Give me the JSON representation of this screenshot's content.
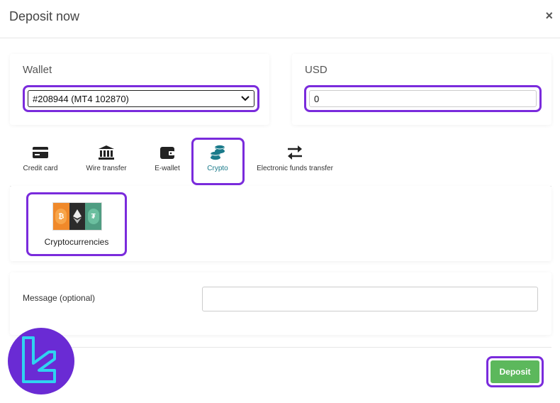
{
  "header": {
    "title": "Deposit now",
    "close_glyph": "×"
  },
  "wallet": {
    "label": "Wallet",
    "selected": "#208944 (MT4 102870)"
  },
  "amount": {
    "label": "USD",
    "value": "0"
  },
  "tabs": [
    {
      "label": "Credit card",
      "icon": "credit-card-icon"
    },
    {
      "label": "Wire transfer",
      "icon": "bank-icon"
    },
    {
      "label": "E-wallet",
      "icon": "wallet-icon"
    },
    {
      "label": "Crypto",
      "icon": "coins-icon",
      "active": true
    },
    {
      "label": "Electronic funds transfer",
      "icon": "exchange-arrows-icon"
    }
  ],
  "methods": [
    {
      "label": "Cryptocurrencies"
    }
  ],
  "message": {
    "label": "Message (optional)",
    "value": ""
  },
  "footer": {
    "deposit_label": "Deposit"
  },
  "colors": {
    "highlight": "#7a2bdc",
    "deposit": "#5cb85c",
    "crypto_tab": "#1a7a8a",
    "logo_bg": "#6a2bd4",
    "logo_stroke": "#2fd3f0"
  }
}
